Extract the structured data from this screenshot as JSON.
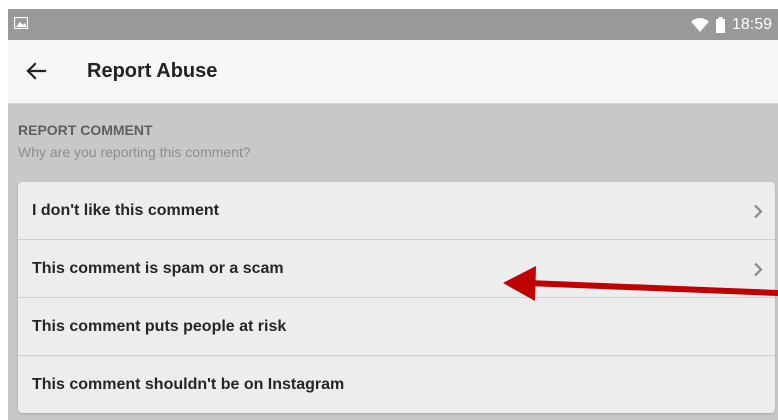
{
  "status_bar": {
    "time": "18:59",
    "icons": [
      "image-icon",
      "wifi-icon",
      "battery-icon"
    ]
  },
  "toolbar": {
    "title": "Report Abuse",
    "back_icon": "arrow-left-icon"
  },
  "section": {
    "title": "REPORT COMMENT",
    "subtitle": "Why are you reporting this comment?"
  },
  "options": [
    {
      "label": "I don't like this comment",
      "has_chevron": true
    },
    {
      "label": "This comment is spam or a scam",
      "has_chevron": true
    },
    {
      "label": "This comment puts people at risk",
      "has_chevron": false
    },
    {
      "label": "This comment shouldn't be on Instagram",
      "has_chevron": false
    }
  ],
  "colors": {
    "status_bar": "#999999",
    "toolbar": "#f7f7f7",
    "background": "#c8c8c8",
    "option_background": "#ededed",
    "annotation_arrow": "#c00000"
  }
}
